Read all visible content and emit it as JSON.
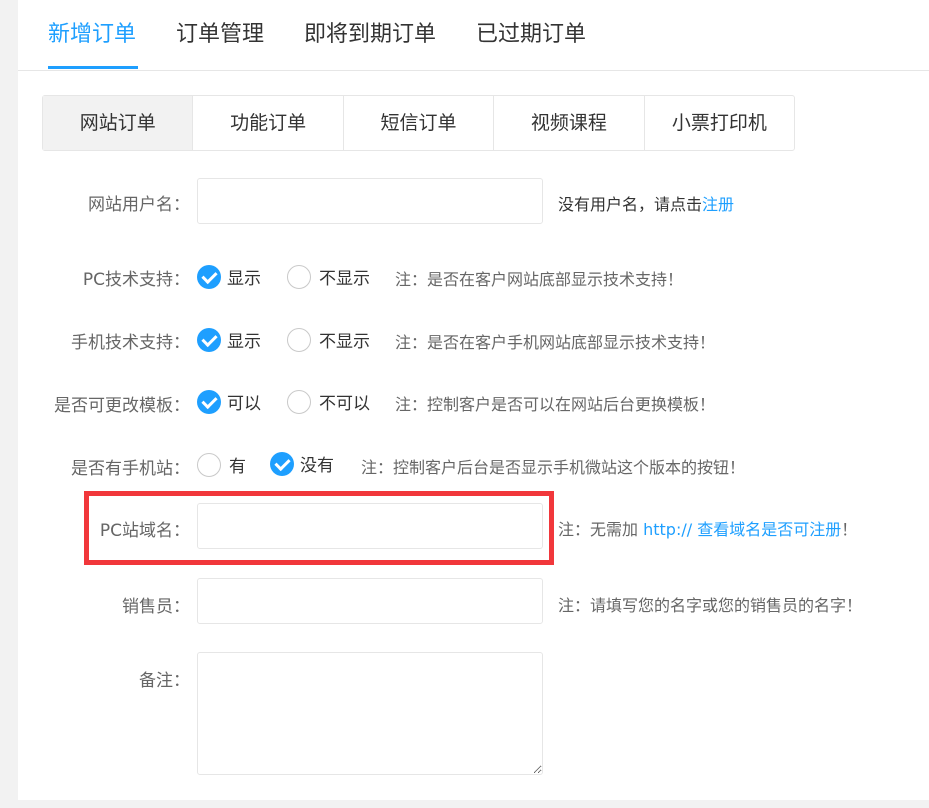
{
  "top_tabs": [
    {
      "label": "新增订单",
      "active": true
    },
    {
      "label": "订单管理"
    },
    {
      "label": "即将到期订单"
    },
    {
      "label": "已过期订单"
    }
  ],
  "sub_tabs": [
    {
      "label": "网站订单",
      "active": true
    },
    {
      "label": "功能订单"
    },
    {
      "label": "短信订单"
    },
    {
      "label": "视频课程"
    },
    {
      "label": "小票打印机"
    }
  ],
  "form": {
    "username": {
      "label": "网站用户名：",
      "value": "",
      "note_text": "没有用户名，请点击",
      "note_link": "注册"
    },
    "pc_support": {
      "label": "PC技术支持：",
      "options": [
        "显示",
        "不显示"
      ],
      "selected": "显示",
      "note": "注：是否在客户网站底部显示技术支持！"
    },
    "mobile_support": {
      "label": "手机技术支持：",
      "options": [
        "显示",
        "不显示"
      ],
      "selected": "显示",
      "note": "注：是否在客户手机网站底部显示技术支持！"
    },
    "template_change": {
      "label": "是否可更改模板：",
      "options": [
        "可以",
        "不可以"
      ],
      "selected": "可以",
      "note": "注：控制客户是否可以在网站后台更换模板！"
    },
    "mobile_site": {
      "label": "是否有手机站：",
      "options": [
        "有",
        "没有"
      ],
      "selected": "没有",
      "note": "注：控制客户后台是否显示手机微站这个版本的按钮！"
    },
    "pc_domain": {
      "label": "PC站域名：",
      "value": "",
      "note_prefix": "注：无需加 ",
      "note_link": "http:// 查看域名是否可注册",
      "note_suffix": "！"
    },
    "salesperson": {
      "label": "销售员：",
      "value": "",
      "note": "注：请填写您的名字或您的销售员的名字！"
    },
    "remark": {
      "label": "备注：",
      "value": ""
    }
  },
  "colors": {
    "accent": "#1e9fff",
    "highlight": "#f1373b"
  }
}
